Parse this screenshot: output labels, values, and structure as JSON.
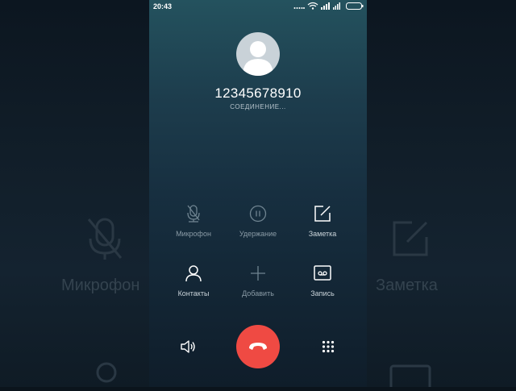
{
  "status_bar": {
    "time": "20:43"
  },
  "call": {
    "number": "12345678910",
    "state": "СОЕДИНЕНИЕ..."
  },
  "controls": {
    "mute": "Микрофон",
    "hold": "Удержание",
    "note": "Заметка",
    "contacts": "Контакты",
    "add": "Добавить",
    "record": "Запись"
  },
  "background_labels": {
    "left": "Микрофон",
    "right": "Заметка"
  },
  "colors": {
    "hangup": "#ef4a43",
    "accent_text": "#ffffff"
  },
  "icons": {
    "avatar": "person-silhouette",
    "mute": "microphone-off-icon",
    "hold": "pause-icon",
    "note": "edit-note-icon",
    "contacts": "person-icon",
    "add": "plus-icon",
    "record": "voicemail-icon",
    "speaker": "speaker-icon",
    "end_call": "phone-hangup-icon",
    "keypad": "dialpad-icon"
  }
}
